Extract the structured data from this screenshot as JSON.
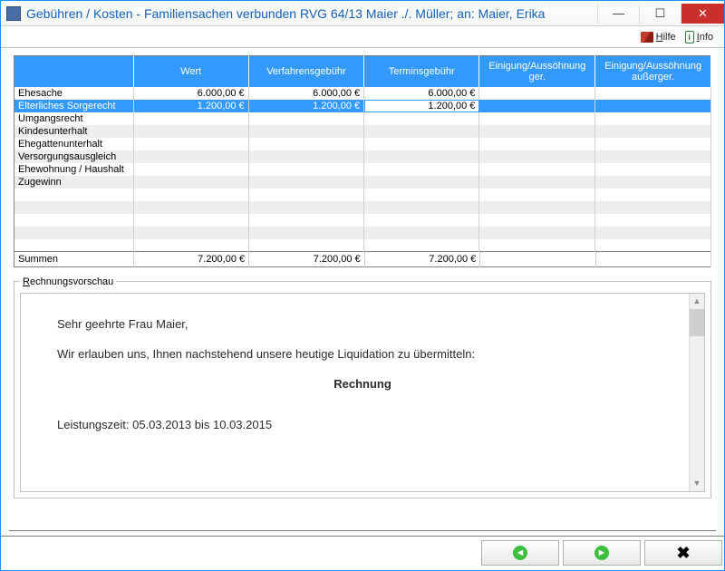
{
  "window": {
    "title": "Gebühren / Kosten - Familiensachen verbunden RVG 64/13 Maier ./. Müller; an: Maier, Erika"
  },
  "toolbar": {
    "help_label": "Hilfe",
    "info_label": "Info"
  },
  "grid": {
    "headers": {
      "c0": "",
      "c1": "Wert",
      "c2": "Verfahrensgebühr",
      "c3": "Terminsgebühr",
      "c4": "Einigung/Aussöhnung ger.",
      "c5": "Einigung/Aussöhnung außerger."
    },
    "rows": [
      {
        "label": "Ehesache",
        "wert": "6.000,00 €",
        "verf": "6.000,00 €",
        "term": "6.000,00 €",
        "eg": "",
        "ea": ""
      },
      {
        "label": "Elterliches Sorgerecht",
        "wert": "1.200,00 €",
        "verf": "1.200,00 €",
        "term": "1.200,00 €",
        "eg": "",
        "ea": ""
      },
      {
        "label": "Umgangsrecht",
        "wert": "",
        "verf": "",
        "term": "",
        "eg": "",
        "ea": ""
      },
      {
        "label": "Kindesunterhalt",
        "wert": "",
        "verf": "",
        "term": "",
        "eg": "",
        "ea": ""
      },
      {
        "label": "Ehegattenunterhalt",
        "wert": "",
        "verf": "",
        "term": "",
        "eg": "",
        "ea": ""
      },
      {
        "label": "Versorgungsausgleich",
        "wert": "",
        "verf": "",
        "term": "",
        "eg": "",
        "ea": ""
      },
      {
        "label": "Ehewohnung / Haushalt",
        "wert": "",
        "verf": "",
        "term": "",
        "eg": "",
        "ea": ""
      },
      {
        "label": "Zugewinn",
        "wert": "",
        "verf": "",
        "term": "",
        "eg": "",
        "ea": ""
      }
    ],
    "sum": {
      "label": "Summen",
      "wert": "7.200,00 €",
      "verf": "7.200,00 €",
      "term": "7.200,00 €",
      "eg": "",
      "ea": ""
    }
  },
  "preview": {
    "legend": "Rechnungsvorschau",
    "greeting": "Sehr geehrte Frau Maier,",
    "intro": "Wir erlauben uns, Ihnen nachstehend unsere heutige Liquidation zu übermitteln:",
    "heading": "Rechnung",
    "period": "Leistungszeit: 05.03.2013 bis 10.03.2015"
  },
  "footer": {
    "back": "←",
    "forward": "→",
    "close": "✖"
  }
}
